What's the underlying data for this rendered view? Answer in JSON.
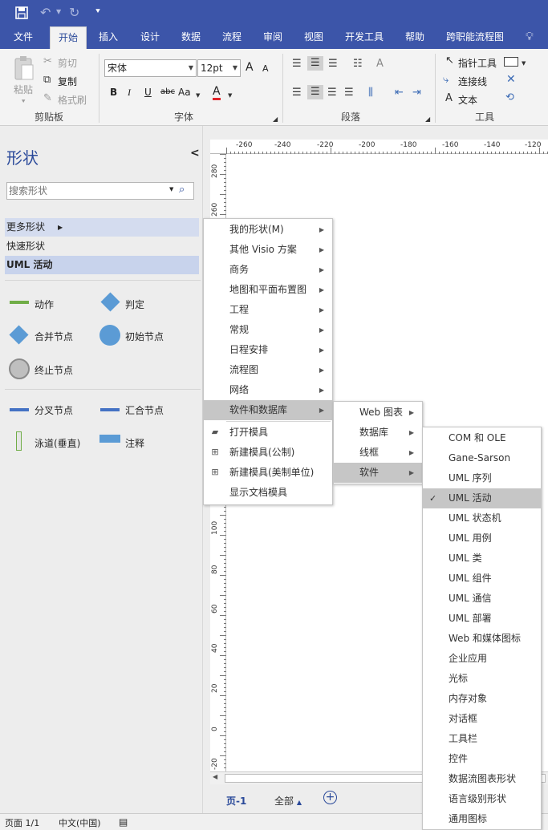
{
  "quick_access": {
    "save": "save-icon",
    "undo": "undo-icon",
    "redo": "redo-icon",
    "customize": "customize-icon"
  },
  "tabs": [
    "文件",
    "开始",
    "插入",
    "设计",
    "数据",
    "流程",
    "审阅",
    "视图",
    "开发工具",
    "帮助",
    "跨职能流程图"
  ],
  "ribbon": {
    "clipboard": {
      "paste": "粘贴",
      "cut": "剪切",
      "copy": "复制",
      "format_painter": "格式刷",
      "group": "剪贴板"
    },
    "font": {
      "font_name": "宋体",
      "font_size": "12pt",
      "grow": "A",
      "shrink": "A",
      "bold": "B",
      "italic": "I",
      "underline": "U",
      "strike": "abc",
      "case": "Aa",
      "color": "A",
      "group": "字体"
    },
    "paragraph": {
      "group": "段落"
    },
    "tools": {
      "pointer": "指针工具",
      "connector": "连接线",
      "text_tool": "文本",
      "text_icon": "A",
      "group": "工具"
    }
  },
  "shapes_panel": {
    "title": "形状",
    "collapse": "<",
    "search_placeholder": "搜索形状",
    "nav": [
      "更多形状",
      "快速形状",
      "UML 活动"
    ],
    "shapes": [
      "动作",
      "判定",
      "合并节点",
      "初始节点",
      "终止节点",
      "分叉节点",
      "汇合节点",
      "泳道(垂直)",
      "注释"
    ]
  },
  "ruler": {
    "h_labels": [
      "-260",
      "-240",
      "-220",
      "-200",
      "-180",
      "-160",
      "-140",
      "-120"
    ],
    "v_labels": [
      "280",
      "260",
      "100",
      "80",
      "60",
      "40",
      "20",
      "0",
      "-20"
    ]
  },
  "menu1": {
    "items": [
      "我的形状(M)",
      "其他 Visio 方案",
      "商务",
      "地图和平面布置图",
      "工程",
      "常规",
      "日程安排",
      "流程图",
      "网络",
      "软件和数据库"
    ],
    "bottom_items": [
      "打开模具",
      "新建模具(公制)",
      "新建模具(美制单位)",
      "显示文档模具"
    ],
    "highlighted": "软件和数据库"
  },
  "menu2": {
    "items": [
      "Web 图表",
      "数据库",
      "线框",
      "软件"
    ],
    "highlighted": "软件"
  },
  "menu3": {
    "items": [
      "COM 和 OLE",
      "Gane-Sarson",
      "UML 序列",
      "UML 活动",
      "UML 状态机",
      "UML 用例",
      "UML 类",
      "UML 组件",
      "UML 通信",
      "UML 部署",
      "Web 和媒体图标",
      "企业应用",
      "光标",
      "内存对象",
      "对话框",
      "工具栏",
      "控件",
      "数据流图表形状",
      "语言级别形状",
      "通用图标"
    ],
    "checked": "UML 活动",
    "check_mark": "✓"
  },
  "page_tabs": {
    "page": "页-1",
    "all": "全部",
    "add": "+"
  },
  "status": {
    "page": "页面 1/1",
    "language": "中文(中国)"
  },
  "colors": {
    "accent": "#3c55a9",
    "highlight": "#c6c6c6",
    "shape_blue": "#5b9bd5",
    "shape_green": "#70ad47"
  }
}
